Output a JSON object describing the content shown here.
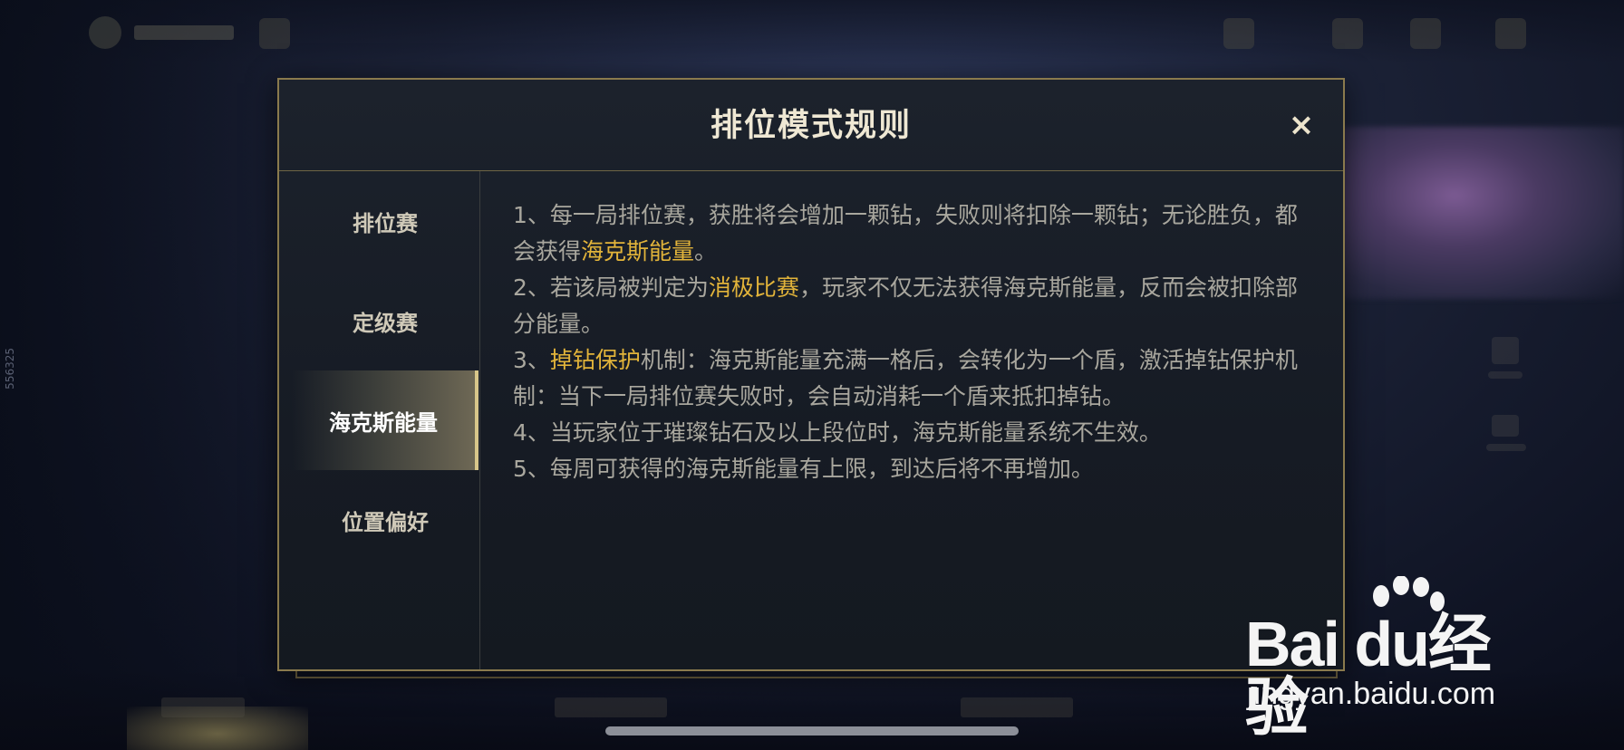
{
  "dialog": {
    "title": "排位模式规则",
    "close_icon": "×"
  },
  "sidebar": {
    "tabs": [
      {
        "label": "排位赛",
        "active": false
      },
      {
        "label": "定级赛",
        "active": false
      },
      {
        "label": "海克斯能量",
        "active": true
      },
      {
        "label": "位置偏好",
        "active": false
      }
    ]
  },
  "rules": {
    "r1_a": "1、每一局排位赛，获胜将会增加一颗钻，失败则将扣除一颗钻；无论胜负，都会获得",
    "r1_hl": "海克斯能量",
    "r1_b": "。",
    "r2_a": "2、若该局被判定为",
    "r2_hl": "消极比赛",
    "r2_b": "，玩家不仅无法获得海克斯能量，反而会被扣除部分能量。",
    "r3_a": "3、",
    "r3_hl": "掉钻保护",
    "r3_b": "机制：海克斯能量充满一格后，会转化为一个盾，激活掉钻保护机制：当下一局排位赛失败时，会自动消耗一个盾来抵扣掉钻。",
    "r4": "4、当玩家位于璀璨钻石及以上段位时，海克斯能量系统不生效。",
    "r5": "5、每周可获得的海克斯能量有上限，到达后将不再增加。"
  },
  "side_id": "556325",
  "watermark": {
    "logo_text": "Bai  du经验",
    "url": "jingyan.baidu.com"
  },
  "colors": {
    "highlight": "#e2b43a",
    "border_gold": "#8a7a4d",
    "body_text": "#a9a79e"
  }
}
